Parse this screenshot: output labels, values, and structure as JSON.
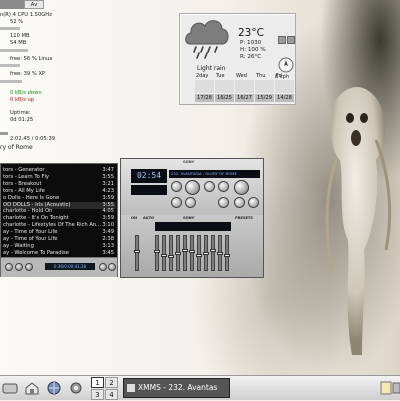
{
  "sysmon": {
    "tab_label": "Av",
    "cpu_line": "n(R) 4 CPU 1.50GHz",
    "cpu_pct": "52 %",
    "mem_total": "110 MB",
    "mem_used": "54 MB",
    "disk1": "free: 56 % Linux",
    "disk2": "free: 39 % XP",
    "net_down": "0 kB/s down",
    "net_up": "0 kB/s up",
    "uptime_label": "Uptime:",
    "uptime_value": "0d 01:25",
    "track_time": "2:02:45 / 0:05:39",
    "track_name": "ry of Rome"
  },
  "weather": {
    "temp": "23°C",
    "pressure": "P: 1030",
    "humidity": "H: 100 %",
    "realfeel": "R: 26°C",
    "condition": "Light rain",
    "wind": "8 kph",
    "days": [
      {
        "name": "2day",
        "temps": "17/28"
      },
      {
        "name": "Tue",
        "temps": "16/25"
      },
      {
        "name": "Wed",
        "temps": "16/27"
      },
      {
        "name": "Thu",
        "temps": "15/29"
      },
      {
        "name": "Fri",
        "temps": "14/28"
      }
    ]
  },
  "playlist": {
    "rows": [
      {
        "title": "tors - Generator",
        "dur": "3:47"
      },
      {
        "title": "tors - Learn To Fly",
        "dur": "3:55"
      },
      {
        "title": "tors - Breakout",
        "dur": "3:21"
      },
      {
        "title": "tors - All My Life",
        "dur": "4:23"
      },
      {
        "title": "o Dolls - Here Is Gone",
        "dur": "3:59"
      },
      {
        "title": "OO DOLLS - Iris (Acoustic)",
        "dur": "3:55"
      },
      {
        "title": "charlotte - Hold On",
        "dur": "4:05"
      },
      {
        "title": "charlotte - It's On Tonight",
        "dur": "3:59"
      },
      {
        "title": "charlotte - Lifestyles Of The Rich An...",
        "dur": "3:10"
      },
      {
        "title": "ay - Time of Your Life",
        "dur": "3:49"
      },
      {
        "title": "ay - Time of Your Life",
        "dur": "2:38"
      },
      {
        "title": "ay - Waiting",
        "dur": "3:13"
      },
      {
        "title": "ay - Welcome To Paradise",
        "dur": "3:45"
      }
    ],
    "selected_index": 5,
    "lcd_text": "0:36/0:00:41:28"
  },
  "xmms": {
    "brand": "SONY",
    "time": "02:54",
    "title_ticker": "232. AVANTASIA - GLORY OF ROME",
    "eq_label": "SONY",
    "eq_on": "ON",
    "eq_auto": "AUTO",
    "eq_presets": "PRESETS",
    "eq_band_levels": [
      0.55,
      0.45,
      0.4,
      0.5,
      0.6,
      0.55,
      0.45,
      0.5,
      0.6,
      0.5,
      0.45
    ]
  },
  "taskbar": {
    "pager": [
      "1",
      "2",
      "3",
      "4"
    ],
    "active_desktop": "1",
    "task_title": "XMMS - 232. Avantas"
  }
}
